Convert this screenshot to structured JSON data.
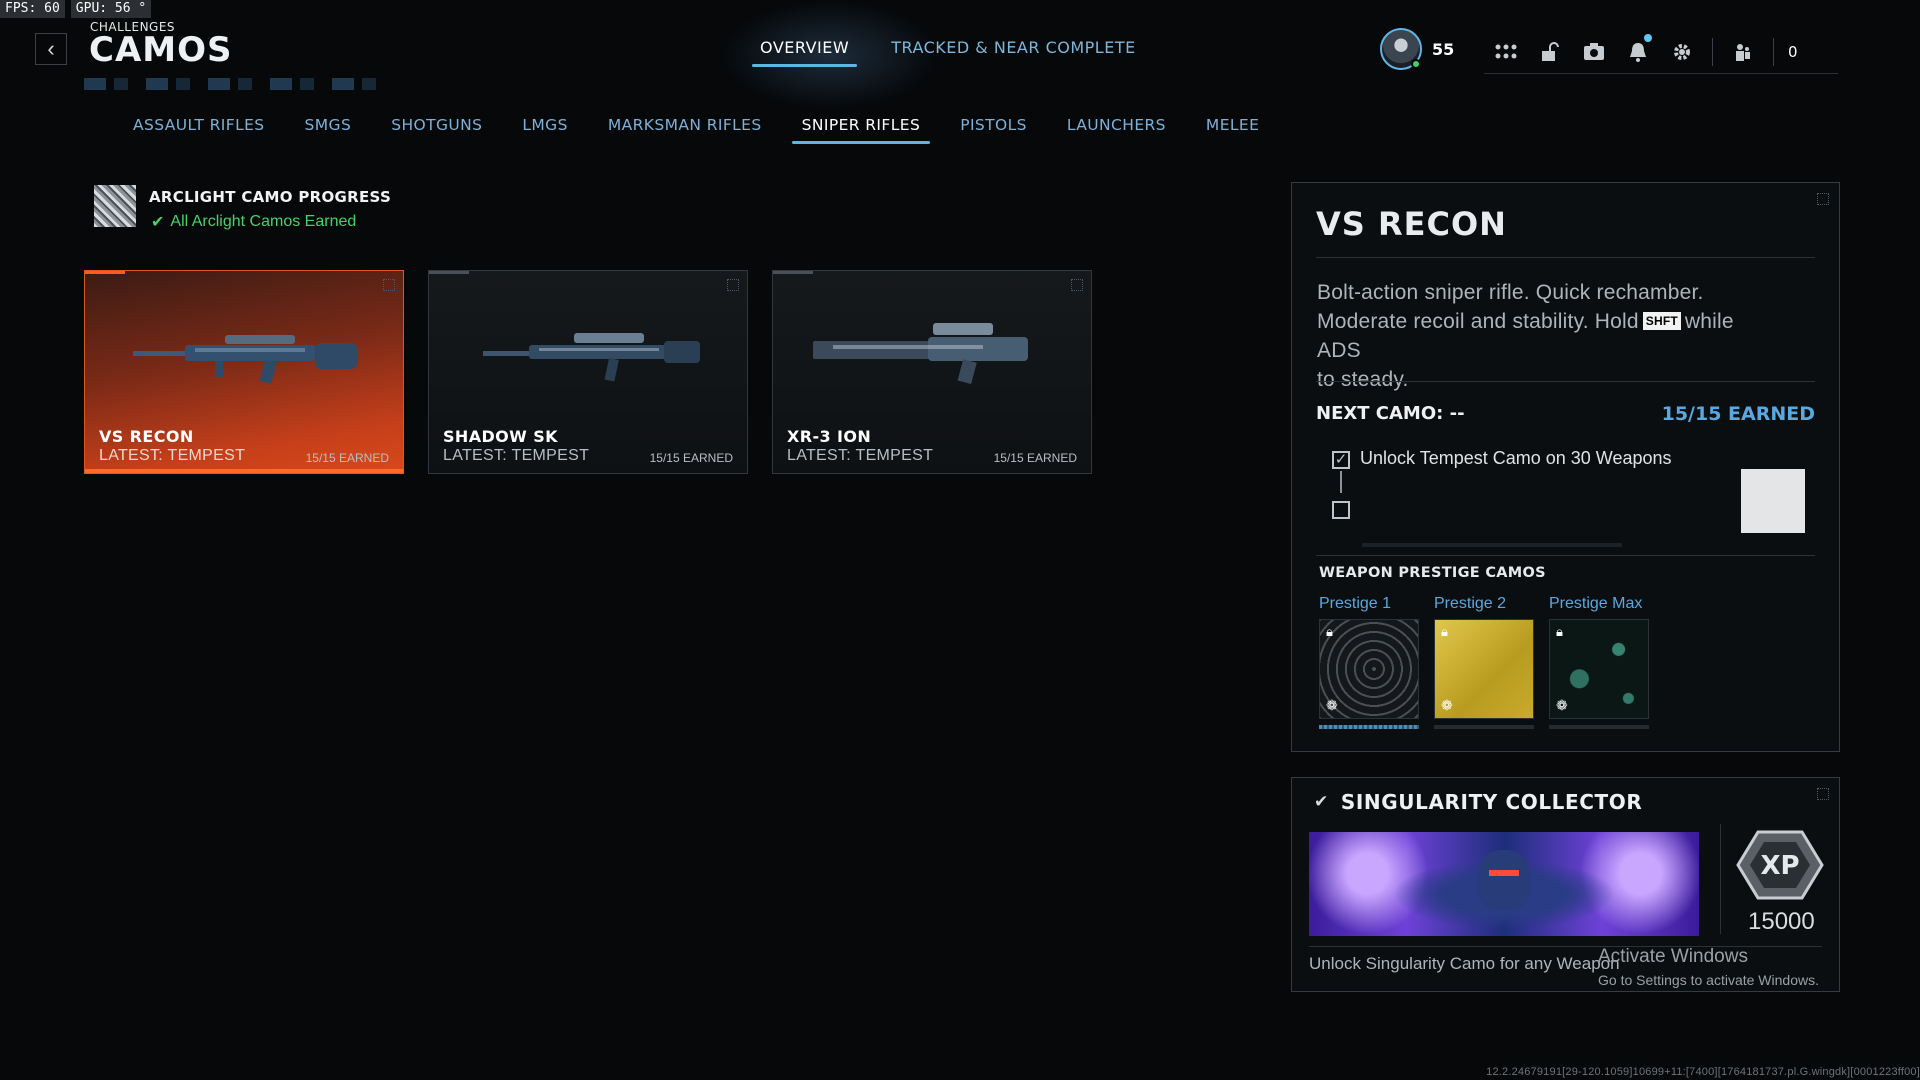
{
  "perf": {
    "fps": "FPS:  60",
    "gpu": "GPU: 56 °"
  },
  "header": {
    "breadcrumb": "CHALLENGES",
    "title": "CAMOS",
    "tabs": [
      {
        "label": "OVERVIEW",
        "active": true
      },
      {
        "label": "TRACKED & NEAR COMPLETE",
        "active": false
      }
    ],
    "player_level": "55",
    "currency": "0"
  },
  "categories": [
    {
      "label": "ASSAULT RIFLES",
      "active": false
    },
    {
      "label": "SMGS",
      "active": false
    },
    {
      "label": "SHOTGUNS",
      "active": false
    },
    {
      "label": "LMGS",
      "active": false
    },
    {
      "label": "MARKSMAN RIFLES",
      "active": false
    },
    {
      "label": "SNIPER RIFLES",
      "active": true
    },
    {
      "label": "PISTOLS",
      "active": false
    },
    {
      "label": "LAUNCHERS",
      "active": false
    },
    {
      "label": "MELEE",
      "active": false
    }
  ],
  "arclight": {
    "title": "ARCLIGHT CAMO PROGRESS",
    "status": "All Arclight Camos Earned",
    "status_color": "#48d169"
  },
  "weapons": [
    {
      "name": "VS RECON",
      "latest": "LATEST: TEMPEST",
      "earned": "15/15 EARNED",
      "selected": true
    },
    {
      "name": "SHADOW SK",
      "latest": "LATEST: TEMPEST",
      "earned": "15/15 EARNED",
      "selected": false
    },
    {
      "name": "XR-3 ION",
      "latest": "LATEST: TEMPEST",
      "earned": "15/15 EARNED",
      "selected": false
    }
  ],
  "detail": {
    "title": "VS RECON",
    "desc_line1": "Bolt-action sniper rifle.  Quick rechamber.",
    "desc_line2a": "Moderate recoil and stability.  Hold",
    "key": "SHFT",
    "desc_line2b": "while ADS",
    "desc_line3": "to steady.",
    "next_camo": "NEXT CAMO: --",
    "earned": "15/15 EARNED",
    "challenge": "Unlock Tempest Camo on 30 Weapons",
    "prestige_heading": "WEAPON PRESTIGE CAMOS",
    "prestige": [
      {
        "label": "Prestige 1"
      },
      {
        "label": "Prestige 2"
      },
      {
        "label": "Prestige Max"
      }
    ]
  },
  "singularity": {
    "title": "SINGULARITY COLLECTOR",
    "description": "Unlock Singularity Camo for any Weapon",
    "xp_label": "XP",
    "xp_value": "15000"
  },
  "watermark": {
    "line1": "Activate Windows",
    "line2": "Go to Settings to activate Windows."
  },
  "build_info": "12.2.24679191[29-120.1059]10699+11:[7400][1764181737.pl.G.wingdk][0001223ff00]",
  "colors": {
    "accent_blue": "#5fb6e4",
    "selected_orange": "#d8491c",
    "link_blue": "#5aa8e0"
  }
}
